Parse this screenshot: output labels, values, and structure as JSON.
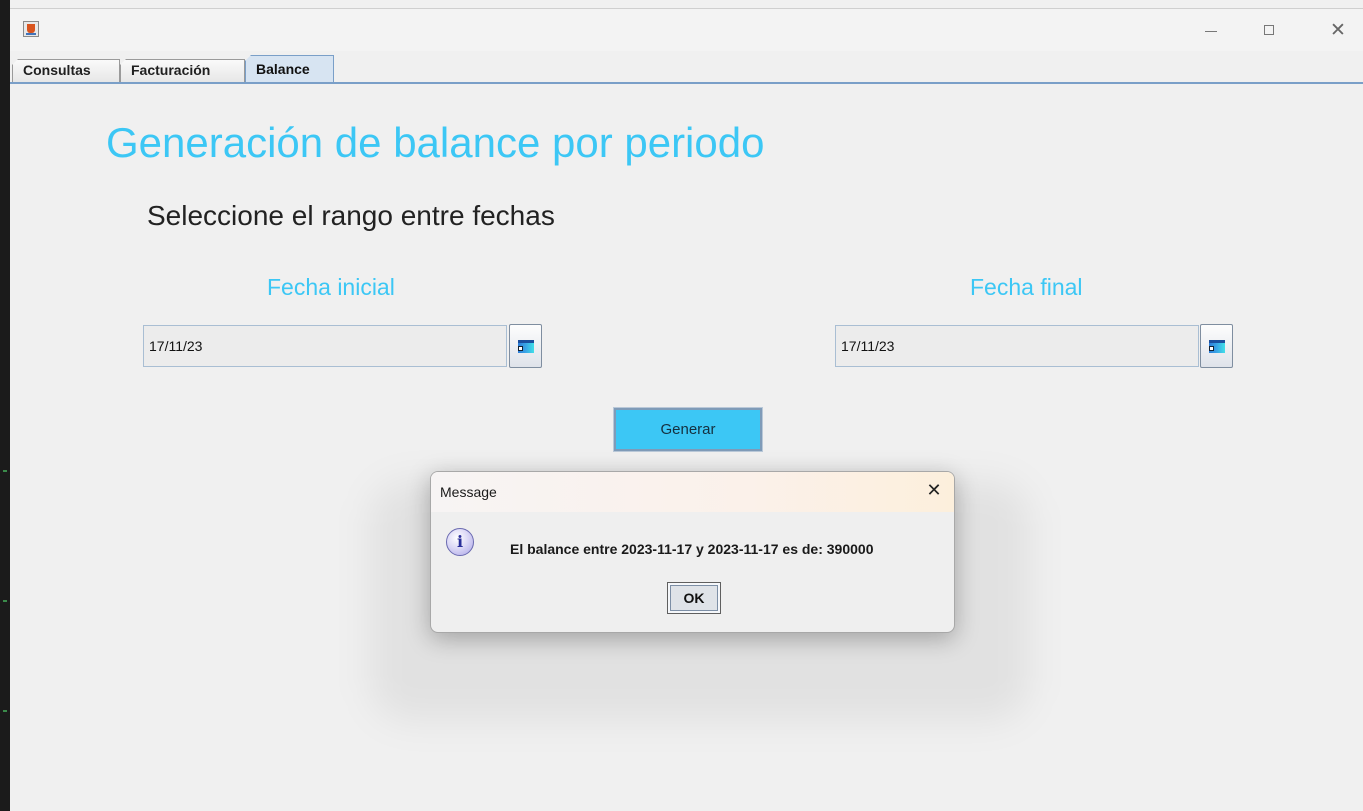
{
  "window": {
    "icon": "java-cup-icon"
  },
  "tabs": [
    {
      "label": "Consultas"
    },
    {
      "label": "Facturación"
    },
    {
      "label": "Balance",
      "selected": true
    }
  ],
  "content": {
    "title": "Generación de balance por periodo",
    "subtitle": "Seleccione el rango entre fechas",
    "start_label": "Fecha inicial",
    "start_value": "17/11/23",
    "end_label": "Fecha final",
    "end_value": "17/11/23",
    "generate_label": "Generar"
  },
  "dialog": {
    "title": "Message",
    "icon": "info-icon",
    "message": "El balance entre 2023-11-17 y 2023-11-17 es de: 390000",
    "ok_label": "OK"
  },
  "colors": {
    "accent": "#3cc7f5",
    "tab_selected": "#d7e4f2"
  }
}
